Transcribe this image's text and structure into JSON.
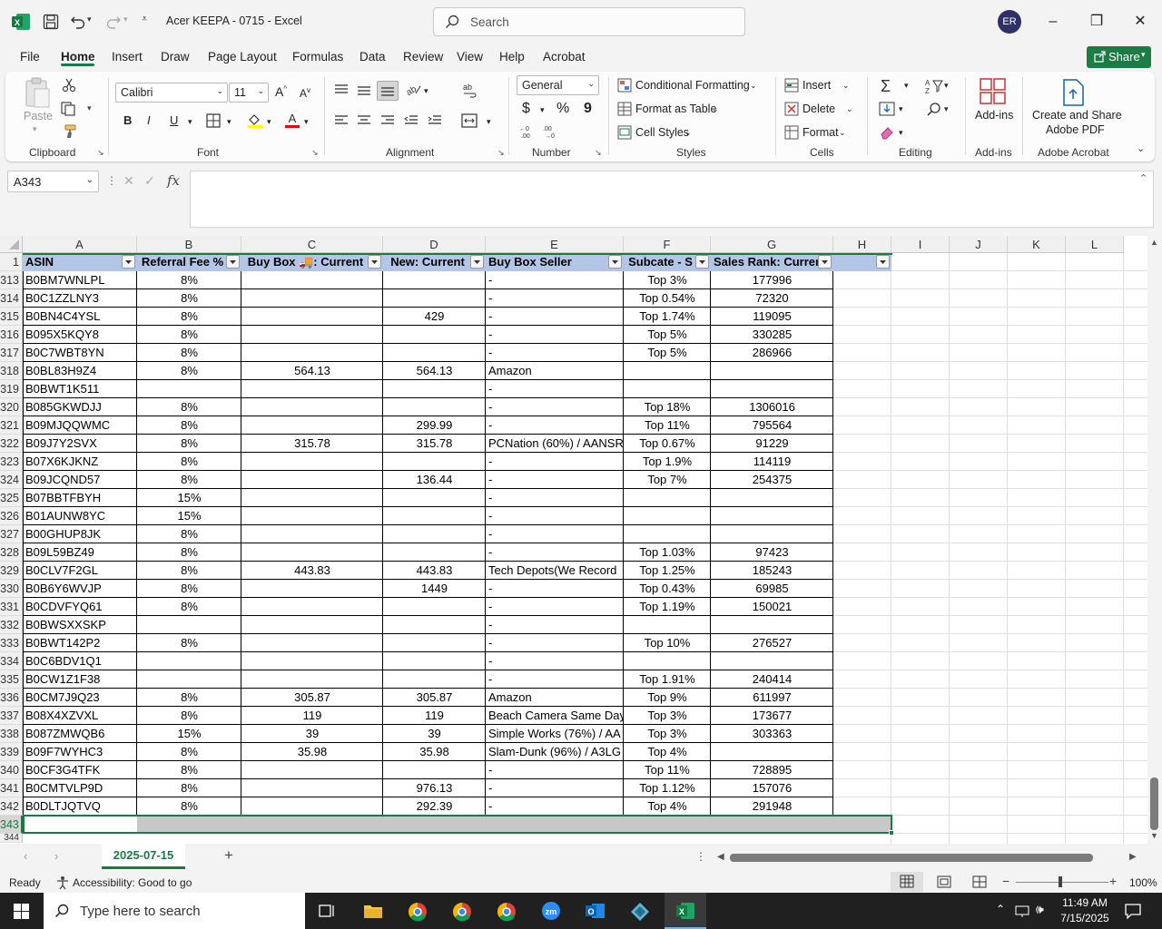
{
  "app": {
    "window_title": "Acer KEEPA - 0715  -  Excel",
    "search_placeholder": "Search",
    "user_initials": "ER"
  },
  "tabs": [
    "File",
    "Home",
    "Insert",
    "Draw",
    "Page Layout",
    "Formulas",
    "Data",
    "Review",
    "View",
    "Help",
    "Acrobat"
  ],
  "share_label": "Share",
  "ribbon": {
    "clipboard": {
      "paste": "Paste",
      "label": "Clipboard"
    },
    "font": {
      "name": "Calibri",
      "size": "11",
      "bold": "B",
      "italic": "I",
      "underline": "U",
      "label": "Font"
    },
    "alignment": {
      "label": "Alignment"
    },
    "number": {
      "format": "General",
      "currency": "$",
      "percent": "%",
      "comma": "9",
      "label": "Number"
    },
    "styles": {
      "conditional": "Conditional Formatting",
      "table": "Format as Table",
      "cell": "Cell Styles",
      "label": "Styles"
    },
    "cells": {
      "insert": "Insert",
      "delete": "Delete",
      "format": "Format",
      "label": "Cells"
    },
    "editing": {
      "label": "Editing"
    },
    "addins": {
      "button": "Add-ins",
      "label": "Add-ins"
    },
    "acrobat": {
      "line1": "Create and Share",
      "line2": "Adobe PDF",
      "label": "Adobe Acrobat"
    }
  },
  "formula_bar": {
    "name_box": "A343",
    "fx": "fx",
    "content": ""
  },
  "grid": {
    "columns": [
      "A",
      "B",
      "C",
      "D",
      "E",
      "F",
      "G",
      "H",
      "I",
      "J",
      "K",
      "L"
    ],
    "headers": [
      "ASIN",
      "Referral Fee %",
      "Buy Box 🚚: Current",
      "New: Current",
      "Buy Box Seller",
      "Subcate - S",
      "Sales Rank: Current"
    ],
    "rows": [
      {
        "n": "313",
        "a": "B0BM7WNLPL",
        "b": "8%",
        "c": "",
        "d": "",
        "e": "-",
        "f": "Top 3%",
        "g": "177996"
      },
      {
        "n": "314",
        "a": "B0C1ZZLNY3",
        "b": "8%",
        "c": "",
        "d": "",
        "e": "-",
        "f": "Top 0.54%",
        "g": "72320"
      },
      {
        "n": "315",
        "a": "B0BN4C4YSL",
        "b": "8%",
        "c": "",
        "d": "429",
        "e": "-",
        "f": "Top 1.74%",
        "g": "119095"
      },
      {
        "n": "316",
        "a": "B095X5KQY8",
        "b": "8%",
        "c": "",
        "d": "",
        "e": "-",
        "f": "Top 5%",
        "g": "330285"
      },
      {
        "n": "317",
        "a": "B0C7WBT8YN",
        "b": "8%",
        "c": "",
        "d": "",
        "e": "-",
        "f": "Top 5%",
        "g": "286966"
      },
      {
        "n": "318",
        "a": "B0BL83H9Z4",
        "b": "8%",
        "c": "564.13",
        "d": "564.13",
        "e": "Amazon",
        "f": "",
        "g": ""
      },
      {
        "n": "319",
        "a": "B0BWT1K511",
        "b": "",
        "c": "",
        "d": "",
        "e": "-",
        "f": "",
        "g": ""
      },
      {
        "n": "320",
        "a": "B085GKWDJJ",
        "b": "8%",
        "c": "",
        "d": "",
        "e": "-",
        "f": "Top 18%",
        "g": "1306016"
      },
      {
        "n": "321",
        "a": "B09MJQQWMC",
        "b": "8%",
        "c": "",
        "d": "299.99",
        "e": "-",
        "f": "Top 11%",
        "g": "795564"
      },
      {
        "n": "322",
        "a": "B09J7Y2SVX",
        "b": "8%",
        "c": "315.78",
        "d": "315.78",
        "e": "PCNation (60%) / AANSR",
        "f": "Top 0.67%",
        "g": "91229"
      },
      {
        "n": "323",
        "a": "B07X6KJKNZ",
        "b": "8%",
        "c": "",
        "d": "",
        "e": "-",
        "f": "Top 1.9%",
        "g": "114119"
      },
      {
        "n": "324",
        "a": "B09JCQND57",
        "b": "8%",
        "c": "",
        "d": "136.44",
        "e": "-",
        "f": "Top 7%",
        "g": "254375"
      },
      {
        "n": "325",
        "a": "B07BBTFBYH",
        "b": "15%",
        "c": "",
        "d": "",
        "e": "-",
        "f": "",
        "g": ""
      },
      {
        "n": "326",
        "a": "B01AUNW8YC",
        "b": "15%",
        "c": "",
        "d": "",
        "e": "-",
        "f": "",
        "g": ""
      },
      {
        "n": "327",
        "a": "B00GHUP8JK",
        "b": "8%",
        "c": "",
        "d": "",
        "e": "-",
        "f": "",
        "g": ""
      },
      {
        "n": "328",
        "a": "B09L59BZ49",
        "b": "8%",
        "c": "",
        "d": "",
        "e": "-",
        "f": "Top 1.03%",
        "g": "97423"
      },
      {
        "n": "329",
        "a": "B0CLV7F2GL",
        "b": "8%",
        "c": "443.83",
        "d": "443.83",
        "e": "Tech Depots(We Record",
        "f": "Top 1.25%",
        "g": "185243"
      },
      {
        "n": "330",
        "a": "B0B6Y6WVJP",
        "b": "8%",
        "c": "",
        "d": "1449",
        "e": "-",
        "f": "Top 0.43%",
        "g": "69985"
      },
      {
        "n": "331",
        "a": "B0CDVFYQ61",
        "b": "8%",
        "c": "",
        "d": "",
        "e": "-",
        "f": "Top 1.19%",
        "g": "150021"
      },
      {
        "n": "332",
        "a": "B0BWSXXSKP",
        "b": "",
        "c": "",
        "d": "",
        "e": "-",
        "f": "",
        "g": ""
      },
      {
        "n": "333",
        "a": "B0BWT142P2",
        "b": "8%",
        "c": "",
        "d": "",
        "e": "-",
        "f": "Top 10%",
        "g": "276527"
      },
      {
        "n": "334",
        "a": "B0C6BDV1Q1",
        "b": "",
        "c": "",
        "d": "",
        "e": "-",
        "f": "",
        "g": ""
      },
      {
        "n": "335",
        "a": "B0CW1Z1F38",
        "b": "",
        "c": "",
        "d": "",
        "e": "-",
        "f": "Top 1.91%",
        "g": "240414"
      },
      {
        "n": "336",
        "a": "B0CM7J9Q23",
        "b": "8%",
        "c": "305.87",
        "d": "305.87",
        "e": "Amazon",
        "f": "Top 9%",
        "g": "611997"
      },
      {
        "n": "337",
        "a": "B08X4XZVXL",
        "b": "8%",
        "c": "119",
        "d": "119",
        "e": "Beach Camera Same Day",
        "f": "Top 3%",
        "g": "173677"
      },
      {
        "n": "338",
        "a": "B087ZMWQB6",
        "b": "15%",
        "c": "39",
        "d": "39",
        "e": "Simple Works (76%) / AA",
        "f": "Top 3%",
        "g": "303363"
      },
      {
        "n": "339",
        "a": "B09F7WYHC3",
        "b": "8%",
        "c": "35.98",
        "d": "35.98",
        "e": "Slam-Dunk (96%) / A3LG",
        "f": "Top 4%",
        "g": ""
      },
      {
        "n": "340",
        "a": "B0CF3G4TFK",
        "b": "8%",
        "c": "",
        "d": "",
        "e": "-",
        "f": "Top 11%",
        "g": "728895"
      },
      {
        "n": "341",
        "a": "B0CMTVLP9D",
        "b": "8%",
        "c": "",
        "d": "976.13",
        "e": "-",
        "f": "Top 1.12%",
        "g": "157076"
      },
      {
        "n": "342",
        "a": "B0DLTJQTVQ",
        "b": "8%",
        "c": "",
        "d": "292.39",
        "e": "-",
        "f": "Top 4%",
        "g": "291948"
      }
    ],
    "selected_row": "343",
    "partial_row": "344",
    "header_row": "1"
  },
  "sheet_tab": "2025-07-15",
  "status": {
    "ready": "Ready",
    "accessibility": "Accessibility: Good to go",
    "zoom": "100%"
  },
  "taskbar": {
    "search_placeholder": "Type here to search",
    "time": "11:49 AM",
    "date": "7/15/2025"
  },
  "colors": {
    "accent": "#1a7a43",
    "table_header": "#b4c6e7",
    "selection": "#c6c6c6"
  }
}
